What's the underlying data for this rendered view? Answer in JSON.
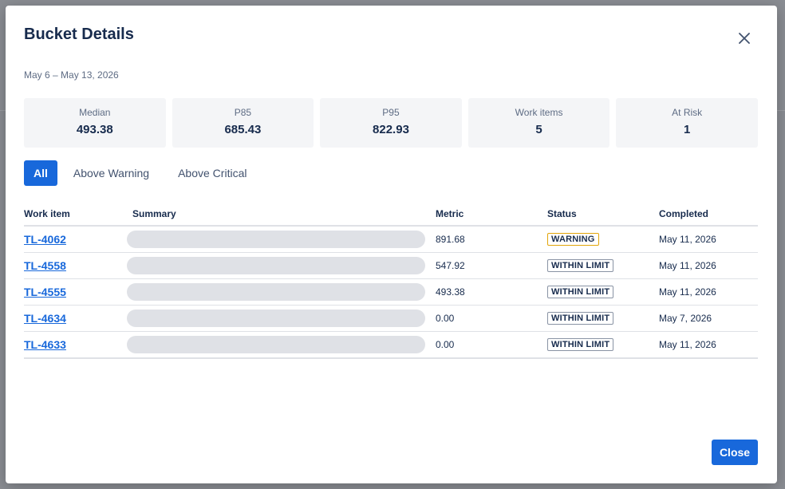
{
  "modal": {
    "title": "Bucket Details",
    "date_range": "May 6 – May 13, 2026",
    "close_label": "Close"
  },
  "stats": [
    {
      "label": "Median",
      "value": "493.38"
    },
    {
      "label": "P85",
      "value": "685.43"
    },
    {
      "label": "P95",
      "value": "822.93"
    },
    {
      "label": "Work items",
      "value": "5"
    },
    {
      "label": "At Risk",
      "value": "1"
    }
  ],
  "filters": [
    {
      "label": "All",
      "active": true
    },
    {
      "label": "Above Warning",
      "active": false
    },
    {
      "label": "Above Critical",
      "active": false
    }
  ],
  "table": {
    "headers": [
      "Work item",
      "Summary",
      "Metric",
      "Status",
      "Completed"
    ],
    "rows": [
      {
        "key": "TL-4062",
        "metric": "891.68",
        "status": "WARNING",
        "completed": "May 11, 2026"
      },
      {
        "key": "TL-4558",
        "metric": "547.92",
        "status": "WITHIN LIMIT",
        "completed": "May 11, 2026"
      },
      {
        "key": "TL-4555",
        "metric": "493.38",
        "status": "WITHIN LIMIT",
        "completed": "May 11, 2026"
      },
      {
        "key": "TL-4634",
        "metric": "0.00",
        "status": "WITHIN LIMIT",
        "completed": "May 7, 2026"
      },
      {
        "key": "TL-4633",
        "metric": "0.00",
        "status": "WITHIN LIMIT",
        "completed": "May 11, 2026"
      }
    ]
  },
  "colors": {
    "accent": "#1868db",
    "warning_border": "#e2a50a",
    "placeholder": "#dfe1e6"
  },
  "icons": {
    "close": "close-icon"
  }
}
